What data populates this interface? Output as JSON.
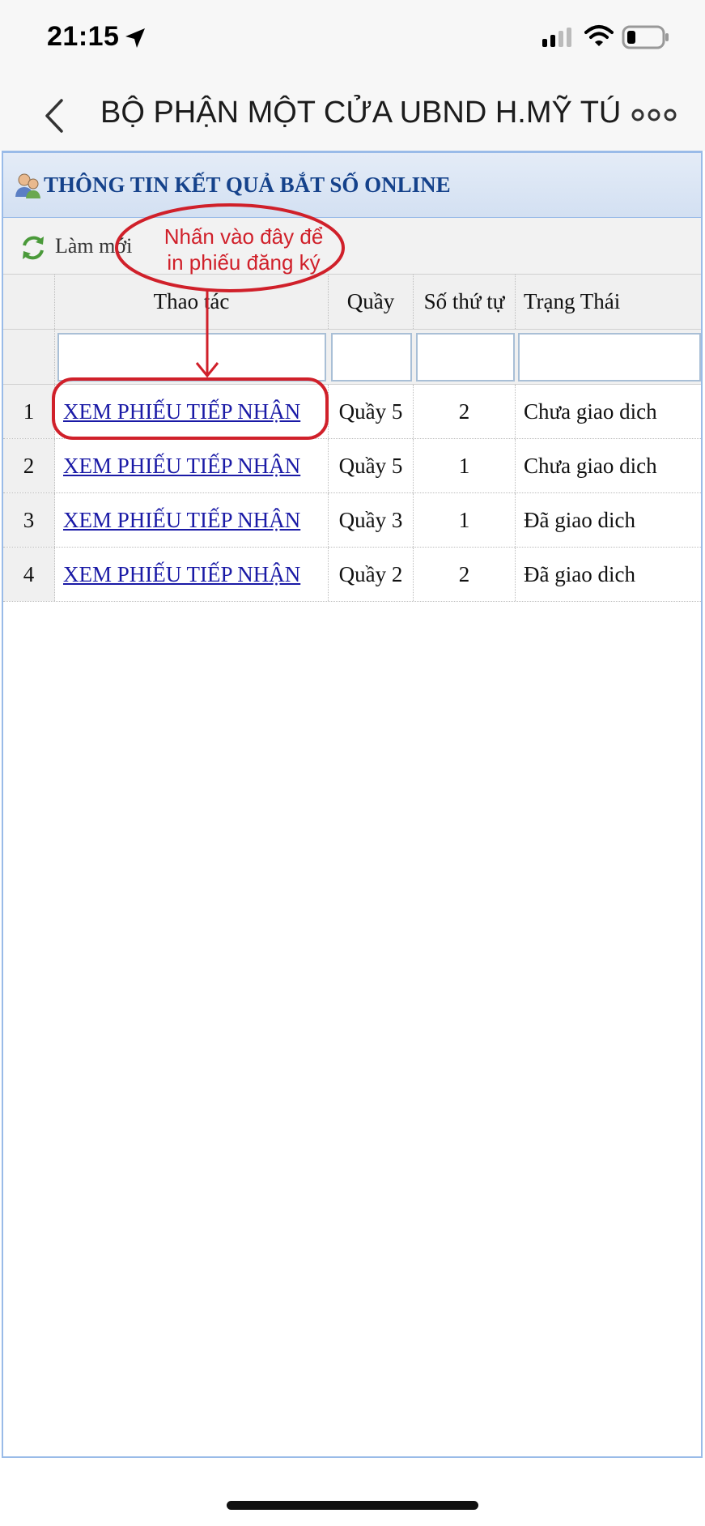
{
  "status_bar": {
    "time": "21:15"
  },
  "nav": {
    "title": "BỘ PHẬN MỘT CỬA UBND H.MỸ TÚ"
  },
  "panel": {
    "title": "THÔNG TIN KẾT QUẢ BẮT SỐ ONLINE"
  },
  "toolbar": {
    "refresh_label": "Làm mới"
  },
  "grid": {
    "columns": [
      "",
      "Thao tác",
      "Quầy",
      "Số thứ tự",
      "Trạng Thái"
    ],
    "rows": [
      {
        "index": "1",
        "action": "XEM PHIẾU TIẾP NHẬN",
        "counter": "Quầy 5",
        "number": "2",
        "status": "Chưa giao dich"
      },
      {
        "index": "2",
        "action": "XEM PHIẾU TIẾP NHẬN",
        "counter": "Quầy 5",
        "number": "1",
        "status": "Chưa giao dich"
      },
      {
        "index": "3",
        "action": "XEM PHIẾU TIẾP NHẬN",
        "counter": "Quầy 3",
        "number": "1",
        "status": "Đã giao dich"
      },
      {
        "index": "4",
        "action": "XEM PHIẾU TIẾP NHẬN",
        "counter": "Quầy 2",
        "number": "2",
        "status": "Đã giao dich"
      }
    ]
  },
  "annotation": {
    "line1": "Nhấn vào đây để",
    "line2": "in phiếu đăng ký",
    "color": "#d0202a"
  },
  "colors": {
    "panel_title": "#15428b",
    "link": "#1a1aa6",
    "border": "#99bbe8"
  },
  "icons": [
    "location-arrow-icon",
    "signal-icon",
    "wifi-icon",
    "battery-icon",
    "back-chevron-icon",
    "more-icon",
    "users-icon",
    "refresh-icon"
  ]
}
